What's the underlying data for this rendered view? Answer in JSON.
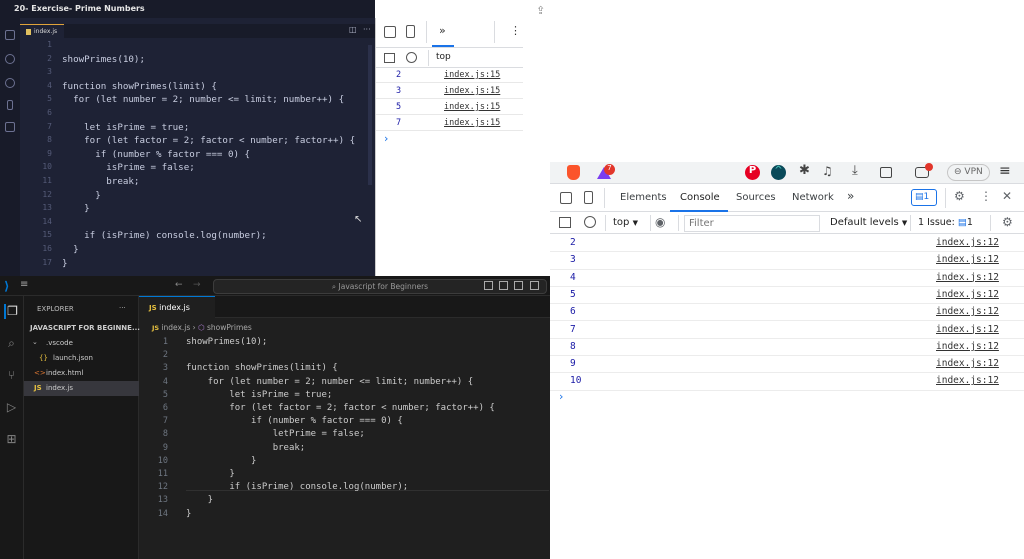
{
  "top_editor": {
    "window_title": "20- Exercise- Prime Numbers",
    "tab_label": "index.js",
    "line_numbers": [
      "1",
      "2",
      "3",
      "4",
      "5",
      "6",
      "7",
      "8",
      "9",
      "10",
      "11",
      "12",
      "13",
      "14",
      "15",
      "16",
      "17"
    ],
    "code_lines": [
      "",
      "showPrimes(10);",
      "",
      "function showPrimes(limit) {",
      "  for (let number = 2; number <= limit; number++) {",
      "",
      "    let isPrime = true;",
      "    for (let factor = 2; factor < number; factor++) {",
      "      if (number % factor === 0) {",
      "        isPrime = false;",
      "        break;",
      "      }",
      "    }",
      "",
      "    if (isPrime) console.log(number);",
      "  }",
      "}"
    ]
  },
  "top_devtools": {
    "more_label": "»",
    "context": "top",
    "rows": [
      {
        "value": "2",
        "source": "index.js:15"
      },
      {
        "value": "3",
        "source": "index.js:15"
      },
      {
        "value": "5",
        "source": "index.js:15"
      },
      {
        "value": "7",
        "source": "index.js:15"
      }
    ],
    "prompt": "›"
  },
  "vscode": {
    "search_text": "Javascript for Beginners",
    "explorer_title": "EXPLORER",
    "explorer_more": "···",
    "project_title": "JAVASCRIPT FOR BEGINNE...",
    "tree": [
      {
        "label": ".vscode",
        "icon": "chevron-down"
      },
      {
        "label": "launch.json",
        "icon": "json-braces"
      },
      {
        "label": "index.html",
        "icon": "html"
      },
      {
        "label": "index.js",
        "icon": "js"
      }
    ],
    "tab_label": "index.js",
    "breadcrumb_file": "index.js",
    "breadcrumb_symbol": "showPrimes",
    "line_numbers": [
      "1",
      "2",
      "3",
      "4",
      "5",
      "6",
      "7",
      "8",
      "9",
      "10",
      "11",
      "12",
      "13",
      "14"
    ],
    "code_lines": [
      "showPrimes(10);",
      "",
      "function showPrimes(limit) {",
      "    for (let number = 2; number <= limit; number++) {",
      "        let isPrime = true;",
      "        for (let factor = 2; factor < number; factor++) {",
      "            if (number % factor === 0) {",
      "                letPrime = false;",
      "                break;",
      "            }",
      "        }",
      "        if (isPrime) console.log(number);",
      "    }",
      "}"
    ]
  },
  "browser_devtools": {
    "tabs": [
      "Elements",
      "Console",
      "Sources",
      "Network"
    ],
    "active_tab": "Console",
    "more_label": "»",
    "issues_badge": "1",
    "context": "top",
    "filter_placeholder": "Filter",
    "levels_label": "Default levels",
    "issue_label": "1 Issue:",
    "issue_count": "1",
    "vpn_label": "VPN",
    "brave_badge": "7",
    "rows": [
      {
        "value": "2",
        "source": "index.js:12"
      },
      {
        "value": "3",
        "source": "index.js:12"
      },
      {
        "value": "4",
        "source": "index.js:12"
      },
      {
        "value": "5",
        "source": "index.js:12"
      },
      {
        "value": "6",
        "source": "index.js:12"
      },
      {
        "value": "7",
        "source": "index.js:12"
      },
      {
        "value": "8",
        "source": "index.js:12"
      },
      {
        "value": "9",
        "source": "index.js:12"
      },
      {
        "value": "10",
        "source": "index.js:12"
      }
    ],
    "prompt": "›"
  },
  "colors": {
    "accent_blue": "#1a73e8",
    "console_number": "#1a1aa6",
    "vscode_active_tab": "#0078d4",
    "brave_orange": "#fb542b",
    "pinterest_red": "#e60023"
  }
}
